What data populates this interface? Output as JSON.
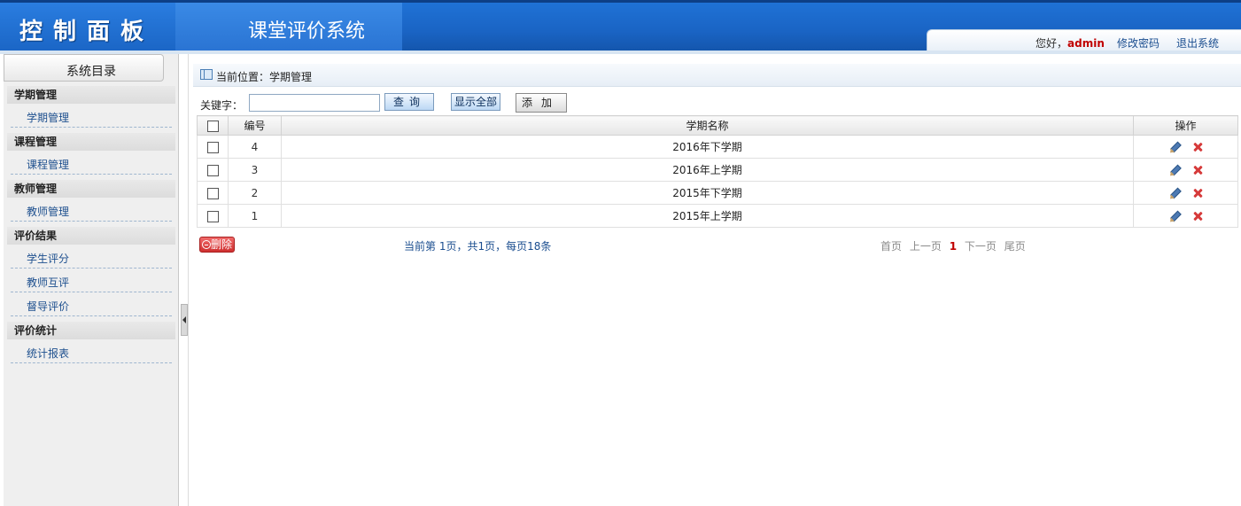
{
  "header": {
    "brand": "控制面板",
    "system_title": "课堂评价系统",
    "greeting_prefix": "您好，",
    "username": "admin",
    "change_password": "修改密码",
    "logout": "退出系统"
  },
  "sidebar": {
    "title": "系统目录",
    "groups": [
      {
        "label": "学期管理",
        "items": [
          "学期管理"
        ]
      },
      {
        "label": "课程管理",
        "items": [
          "课程管理"
        ]
      },
      {
        "label": "教师管理",
        "items": [
          "教师管理"
        ]
      },
      {
        "label": "评价结果",
        "items": [
          "学生评分",
          "教师互评",
          "督导评价"
        ]
      },
      {
        "label": "评价统计",
        "items": [
          "统计报表"
        ]
      }
    ]
  },
  "breadcrumb": "当前位置：学期管理",
  "search": {
    "keyword_label": "关键字：",
    "keyword_value": "",
    "query_button": "查询",
    "show_all_button": "显示全部",
    "add_button": "添加"
  },
  "table": {
    "columns": [
      "编号",
      "学期名称",
      "操作"
    ],
    "rows": [
      {
        "id": "4",
        "name": "2016年下学期"
      },
      {
        "id": "3",
        "name": "2016年上学期"
      },
      {
        "id": "2",
        "name": "2015年下学期"
      },
      {
        "id": "1",
        "name": "2015年上学期"
      }
    ]
  },
  "footer": {
    "delete_button": "删除",
    "page_info": "当前第  1页，共1页，每页18条",
    "first": "首页",
    "prev": "上一页",
    "current": "1",
    "next": "下一页",
    "last": "尾页"
  },
  "icons": {
    "edit": "pencil-icon",
    "delete": "cross-icon",
    "breadcrumb": "panel-icon"
  },
  "colors": {
    "header_blue": "#1a64c4",
    "link_blue": "#1d4f8e",
    "accent_red": "#c00000"
  }
}
